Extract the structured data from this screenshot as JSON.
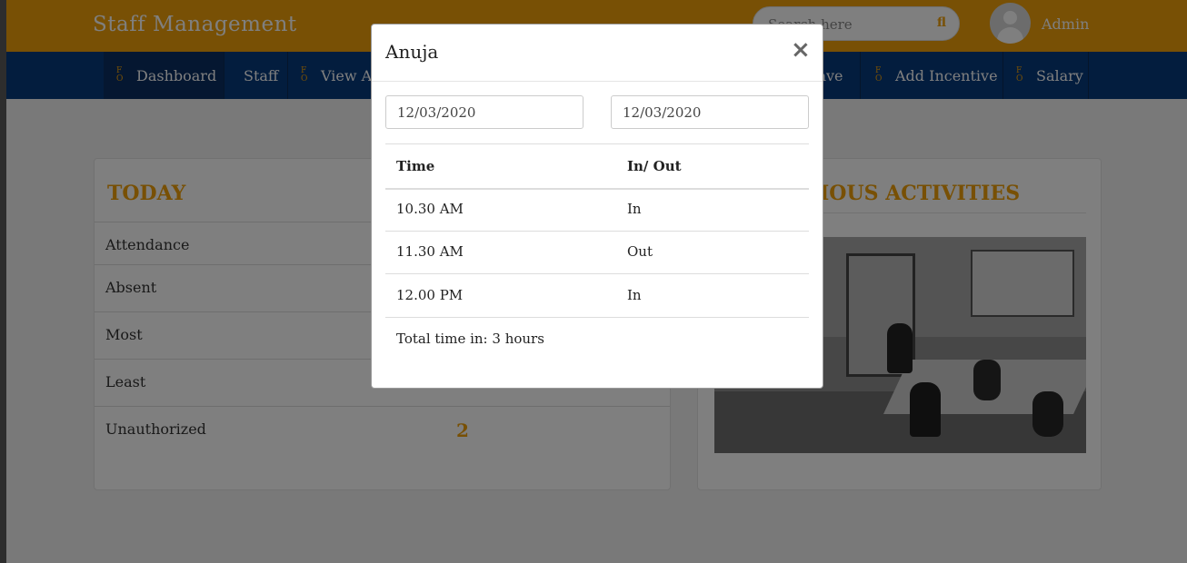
{
  "header": {
    "brand": "Staff Management",
    "search_placeholder": "Search here",
    "search_icon": "search-icon",
    "user": "Admin"
  },
  "nav": {
    "items": [
      {
        "label": "Dashboard",
        "active": true
      },
      {
        "label": "Staff"
      },
      {
        "label": "View At"
      },
      {
        "label": "eave"
      },
      {
        "label": "Add Incentive"
      },
      {
        "label": "Salary"
      }
    ]
  },
  "today": {
    "title": "TODAY",
    "rows": [
      {
        "label": "Attendance",
        "value": ""
      },
      {
        "label": "Absent",
        "value": ""
      },
      {
        "label": "Most",
        "value": ""
      },
      {
        "label": "Least",
        "value": ""
      },
      {
        "label": "Unauthorized",
        "value": "2"
      }
    ]
  },
  "activities": {
    "title": "IOUS ACTIVITIES"
  },
  "modal": {
    "title": "Anuja",
    "close_icon": "×",
    "date_from": "12/03/2020",
    "date_to": "12/03/2020",
    "columns": [
      "Time",
      "In/ Out"
    ],
    "rows": [
      {
        "time": "10.30 AM",
        "status": "In"
      },
      {
        "time": "11.30 AM",
        "status": "Out"
      },
      {
        "time": "12.00 PM",
        "status": "In"
      }
    ],
    "total": "Total time in: 3 hours"
  },
  "colors": {
    "accent": "#f0a10a",
    "nav": "#063a7c",
    "overlay": "rgba(0,0,0,0.5)"
  }
}
